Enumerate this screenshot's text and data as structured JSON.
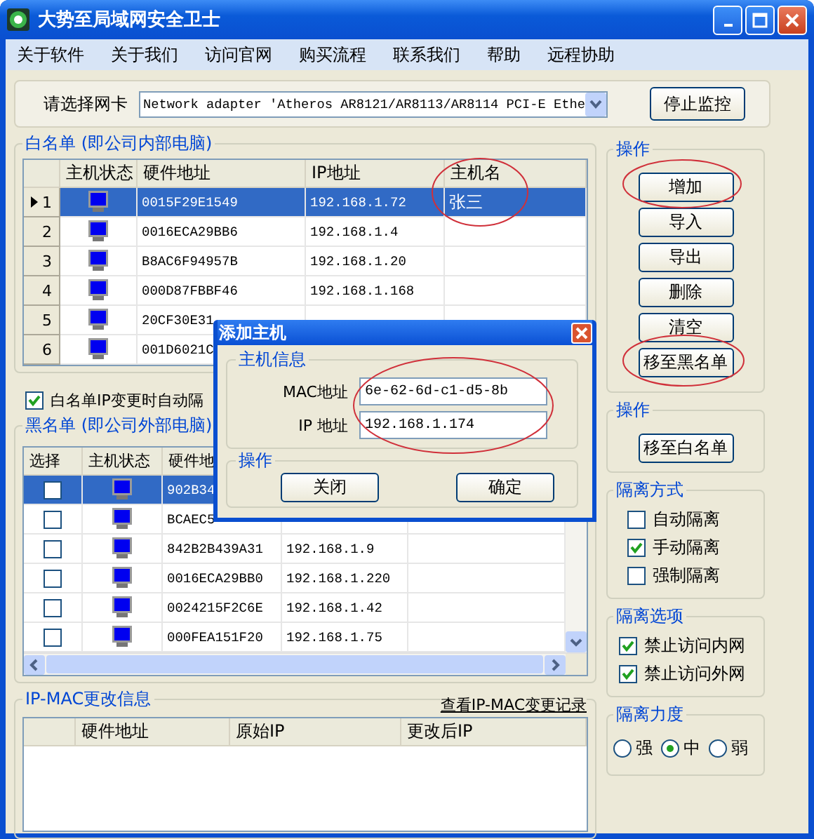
{
  "window": {
    "title": "大势至局域网安全卫士"
  },
  "menu": [
    "关于软件",
    "关于我们",
    "访问官网",
    "购买流程",
    "联系我们",
    "帮助",
    "远程协助"
  ],
  "adapter": {
    "label": "请选择网卡",
    "value": "Network adapter 'Atheros AR8121/AR8113/AR8114 PCI-E Ethe",
    "button": "停止监控"
  },
  "whitelist": {
    "title": "白名单 (即公司内部电脑)",
    "columns": [
      "主机状态",
      "硬件地址",
      "IP地址",
      "主机名"
    ],
    "rows": [
      {
        "index": "1",
        "selected": true,
        "mac": "0015F29E1549",
        "ip": "192.168.1.72",
        "name": "张三"
      },
      {
        "index": "2",
        "selected": false,
        "mac": "0016ECA29BB6",
        "ip": "192.168.1.4"
      },
      {
        "index": "3",
        "selected": false,
        "mac": "B8AC6F94957B",
        "ip": "192.168.1.20"
      },
      {
        "index": "4",
        "selected": false,
        "mac": "000D87FBBF46",
        "ip": "192.168.1.168"
      },
      {
        "index": "5",
        "selected": false,
        "mac": "20CF30E31"
      },
      {
        "index": "6",
        "selected": false,
        "mac": "001D6021C"
      }
    ]
  },
  "auto_isolate": {
    "label": "白名单IP变更时自动隔",
    "checked": true
  },
  "blacklist": {
    "title": "黑名单 (即公司外部电脑)",
    "columns": [
      "选择",
      "主机状态",
      "硬件地"
    ],
    "rows": [
      {
        "selected": true,
        "checked": false,
        "mac": "902B34"
      },
      {
        "selected": false,
        "checked": false,
        "mac": "BCAEC5"
      },
      {
        "selected": false,
        "checked": false,
        "mac": "842B2B439A31",
        "ip": "192.168.1.9"
      },
      {
        "selected": false,
        "checked": false,
        "mac": "0016ECA29BB0",
        "ip": "192.168.1.220"
      },
      {
        "selected": false,
        "checked": false,
        "mac": "0024215F2C6E",
        "ip": "192.168.1.42"
      },
      {
        "selected": false,
        "checked": false,
        "mac": "000FEA151F20",
        "ip": "192.168.1.75"
      }
    ]
  },
  "ipmac": {
    "title": "IP-MAC更改信息",
    "link": "查看IP-MAC变更记录",
    "columns": [
      "硬件地址",
      "原始IP",
      "更改后IP"
    ]
  },
  "actions": {
    "title": "操作",
    "buttons": [
      "增加",
      "导入",
      "导出",
      "删除",
      "清空",
      "移至黑名单"
    ]
  },
  "black_actions": {
    "title": "操作",
    "buttons": [
      "移至白名单"
    ]
  },
  "isolation_mode": {
    "title": "隔离方式",
    "options": [
      {
        "label": "自动隔离",
        "checked": false
      },
      {
        "label": "手动隔离",
        "checked": true
      },
      {
        "label": "强制隔离",
        "checked": false
      }
    ]
  },
  "isolation_options": {
    "title": "隔离选项",
    "options": [
      {
        "label": "禁止访问内网",
        "checked": true
      },
      {
        "label": "禁止访问外网",
        "checked": true
      }
    ]
  },
  "isolation_strength": {
    "title": "隔离力度",
    "options": [
      {
        "label": "强",
        "selected": false
      },
      {
        "label": "中",
        "selected": true
      },
      {
        "label": "弱",
        "selected": false
      }
    ]
  },
  "dialog": {
    "title": "添加主机",
    "info_title": "主机信息",
    "fields": [
      {
        "label": "MAC地址",
        "value": "6e-62-6d-c1-d5-8b"
      },
      {
        "label": "IP 地址",
        "value": "192.168.1.174"
      }
    ],
    "actions_title": "操作",
    "buttons": [
      "关闭",
      "确定"
    ]
  }
}
